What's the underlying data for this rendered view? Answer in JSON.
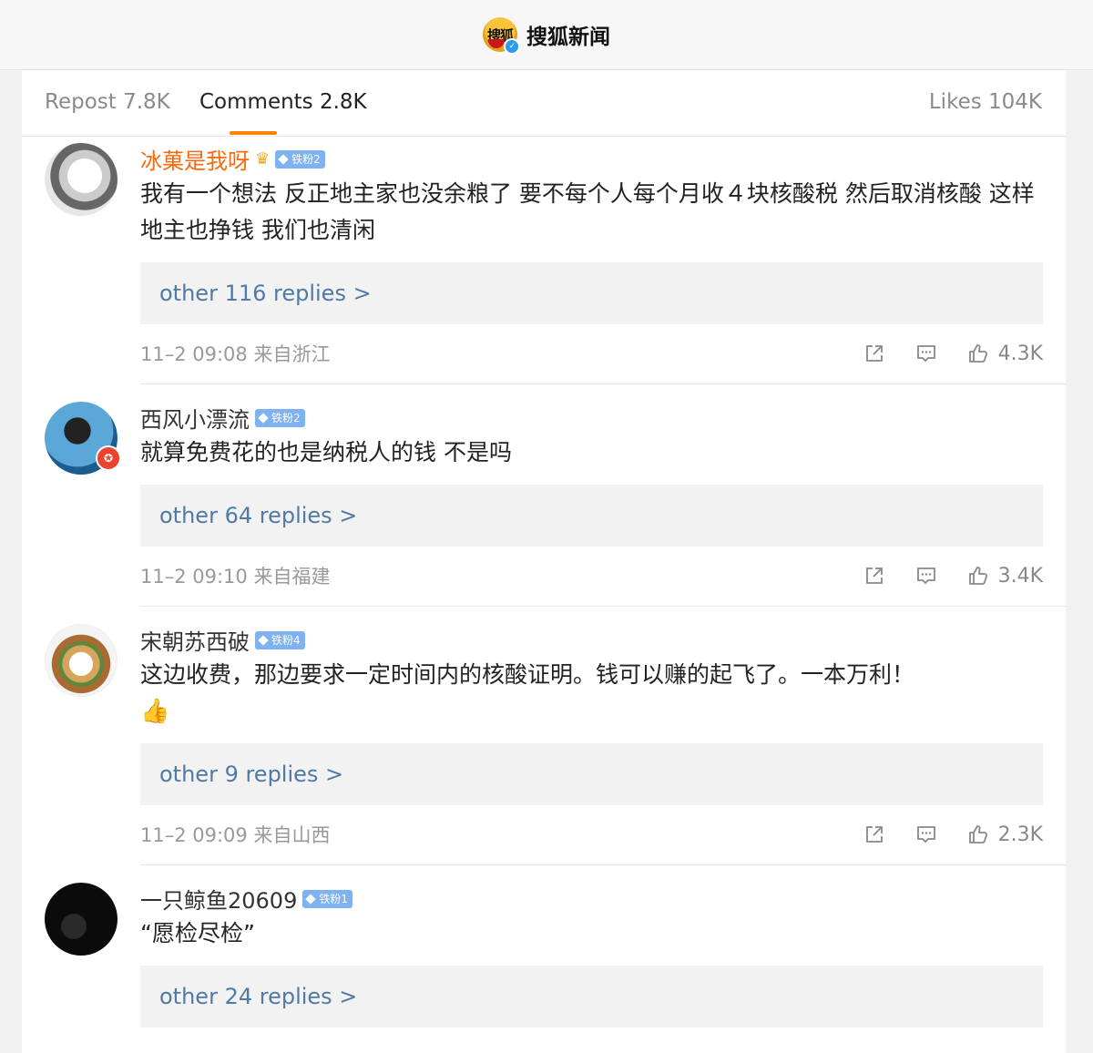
{
  "header": {
    "logo_text": "搜狐",
    "account_name": "搜狐新闻"
  },
  "tabs": {
    "repost": "Repost 7.8K",
    "comments": "Comments 2.8K",
    "likes": "Likes 104K"
  },
  "comments": [
    {
      "username": "冰菓是我呀",
      "fan_badge": "铁粉2",
      "text": "我有一个想法 反正地主家也没余粮了 要不每个人每个月收４块核酸税 然后取消核酸 这样地主也挣钱 我们也清闲",
      "replies": "other 116 replies >",
      "meta": "11–2 09:08 来自浙江",
      "likes": "4.3K"
    },
    {
      "username": "西风小漂流",
      "fan_badge": "铁粉2",
      "text": "就算免费花的也是纳税人的钱 不是吗",
      "replies": "other 64 replies >",
      "meta": "11–2 09:10 来自福建",
      "likes": "3.4K"
    },
    {
      "username": "宋朝苏西破",
      "fan_badge": "铁粉4",
      "text": "这边收费，那边要求一定时间内的核酸证明。钱可以赚的起飞了。一本万利！",
      "emoji": "👍",
      "replies": "other 9 replies >",
      "meta": "11–2 09:09 来自山西",
      "likes": "2.3K"
    },
    {
      "username": "一只鲸鱼20609",
      "fan_badge": "铁粉1",
      "text": "“愿检尽检”",
      "replies": "other 24 replies >"
    }
  ],
  "colors": {
    "accent_orange": "#ff8200",
    "link_blue": "#4f7aa6",
    "vip_name": "#f86a0c",
    "badge_blue": "#7fb2f0"
  }
}
